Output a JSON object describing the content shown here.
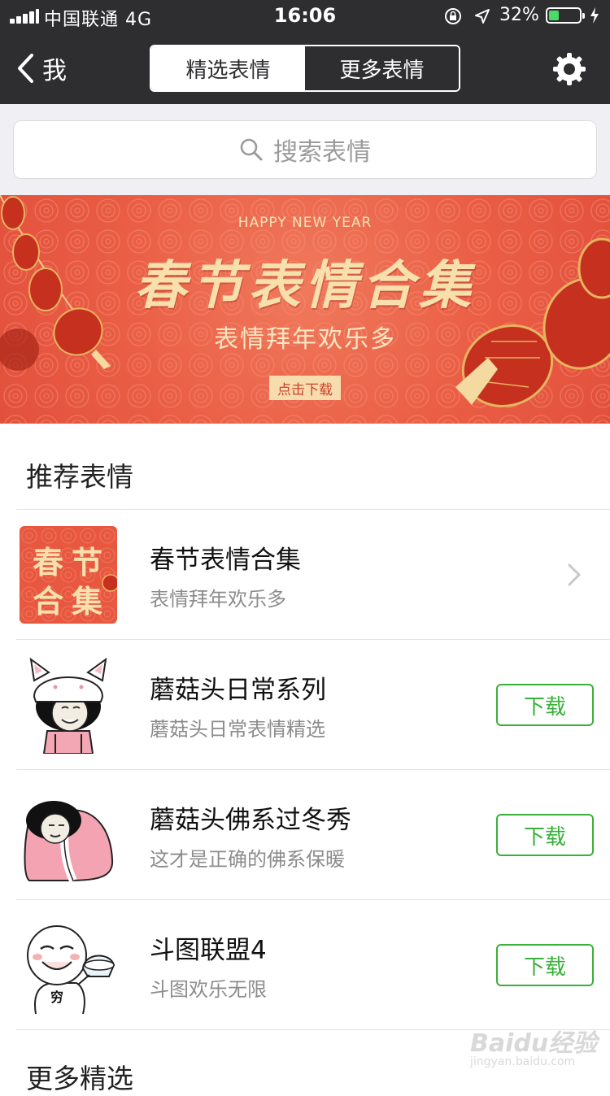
{
  "status_bar": {
    "carrier": "中国联通 4G",
    "time": "16:06",
    "battery_percent": "32%",
    "battery_level": 0.32
  },
  "nav": {
    "back_label": "我",
    "tabs": [
      {
        "label": "精选表情",
        "selected": true
      },
      {
        "label": "更多表情",
        "selected": false
      }
    ],
    "settings_icon": "gear-icon"
  },
  "search": {
    "placeholder": "搜索表情",
    "icon": "search-icon"
  },
  "banner": {
    "eyebrow": "HAPPY NEW YEAR",
    "title": "春节表情合集",
    "subtitle": "表情拜年欢乐多",
    "button_label": "点击下载"
  },
  "recommended": {
    "section_title": "推荐表情",
    "items": [
      {
        "name": "春节表情合集",
        "desc": "表情拜年欢乐多",
        "thumb_text": [
          "春",
          "节",
          "合",
          "集"
        ],
        "action": "chevron"
      },
      {
        "name": "蘑菇头日常系列",
        "desc": "蘑菇头日常表情精选",
        "action": "下载"
      },
      {
        "name": "蘑菇头佛系过冬秀",
        "desc": "这才是正确的佛系保暖",
        "action": "下载"
      },
      {
        "name": "斗图联盟4",
        "desc": "斗图欢乐无限",
        "action": "下载",
        "thumb_text": [
          "穷"
        ]
      }
    ]
  },
  "more_section_title": "更多精选",
  "watermark": {
    "line1": "Baidu经验",
    "line2": "jingyan.baidu.com"
  },
  "colors": {
    "nav_bg": "#2e2e30",
    "accent_green": "#39b03a",
    "banner_red": "#ea5e45",
    "banner_gold": "#f8e0ad"
  }
}
